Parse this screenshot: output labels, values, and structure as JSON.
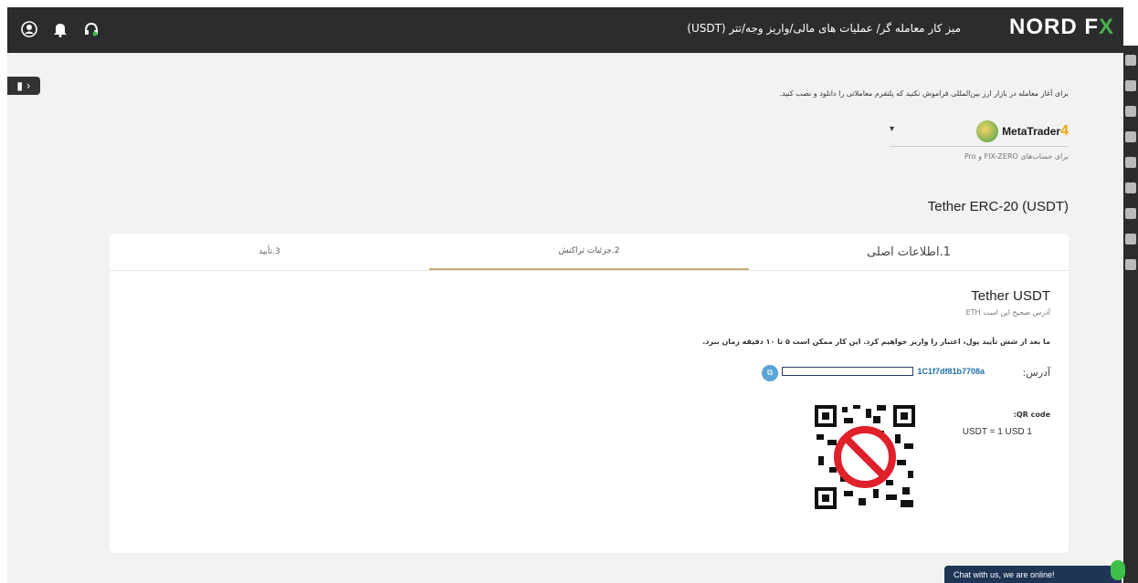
{
  "topbar": {
    "breadcrumb": "میز کار معامله گر/ عملیات های مالی/واریز وجه/تتر (USDT)",
    "logo_main": "NORD F",
    "logo_x": "X",
    "icons": [
      "user-icon",
      "bell-icon",
      "headset-icon"
    ]
  },
  "notice": "برای آغاز معامله در بازار ارز بین‌المللی فراموش نکنید که پلتفرم معاملاتی را دانلود و نصب کنید.",
  "platform": {
    "name": "MetaTrader",
    "version": "4",
    "subtitle": "برای حساب‌های FIX-ZERO و Pro"
  },
  "heading": "Tether ERC-20 (USDT)",
  "tabs": [
    {
      "label": "1.اطلاعات اصلی"
    },
    {
      "label": "2.جزئیات تراکنش"
    },
    {
      "label": "3.تأیید"
    }
  ],
  "details": {
    "title": "Tether USDT",
    "subtitle": "آدرس صحیح این است ETH",
    "info": "ما بعد از شش تأیید پول، اعتبار را واریز خواهیم کرد. این کار ممکن است ۵ تا ۱۰ دقیقه زمان ببرد.",
    "address_label": "آدرس:",
    "address_value": "1C1f7df81b7708a",
    "qr_label": ":QR code",
    "rate": "USDT = 1 USD 1"
  },
  "chat": {
    "label": "Chat with us, we are online!"
  },
  "colors": {
    "topbar": "#2b2c2e",
    "accent_link": "#1f6fa8",
    "tab_active": "#c8a87a",
    "chat_bg": "#1f3556"
  }
}
